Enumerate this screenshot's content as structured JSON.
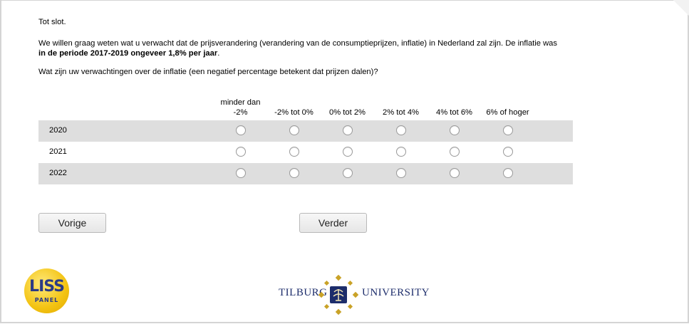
{
  "text": {
    "intro": "Tot slot.",
    "question_part1": "We willen graag weten wat u verwacht dat de prijsverandering (verandering van de consumptieprijzen, inflatie) in Nederland zal zijn. De inflatie was ",
    "question_bold": "in de periode 2017-2019 ongeveer 1,8% per jaar",
    "question_part2": ".",
    "expectation": "Wat zijn uw verwachtingen over de inflatie (een negatief percentage betekent dat prijzen dalen)?"
  },
  "columns": [
    "minder dan -2%",
    "-2% tot 0%",
    "0% tot 2%",
    "2% tot 4%",
    "4% tot 6%",
    "6% of hoger"
  ],
  "rows": [
    "2020",
    "2021",
    "2022"
  ],
  "buttons": {
    "back": "Vorige",
    "next": "Verder"
  },
  "logos": {
    "liss_top": "LISS",
    "liss_bottom": "PANEL",
    "tilburg_left": "TILBURG",
    "tilburg_right": "UNIVERSITY"
  },
  "colors": {
    "row_shade": "#dedede",
    "liss_yellow": "#f3c312",
    "tilburg_blue": "#1d2d6b",
    "tilburg_gold": "#c9a227"
  }
}
